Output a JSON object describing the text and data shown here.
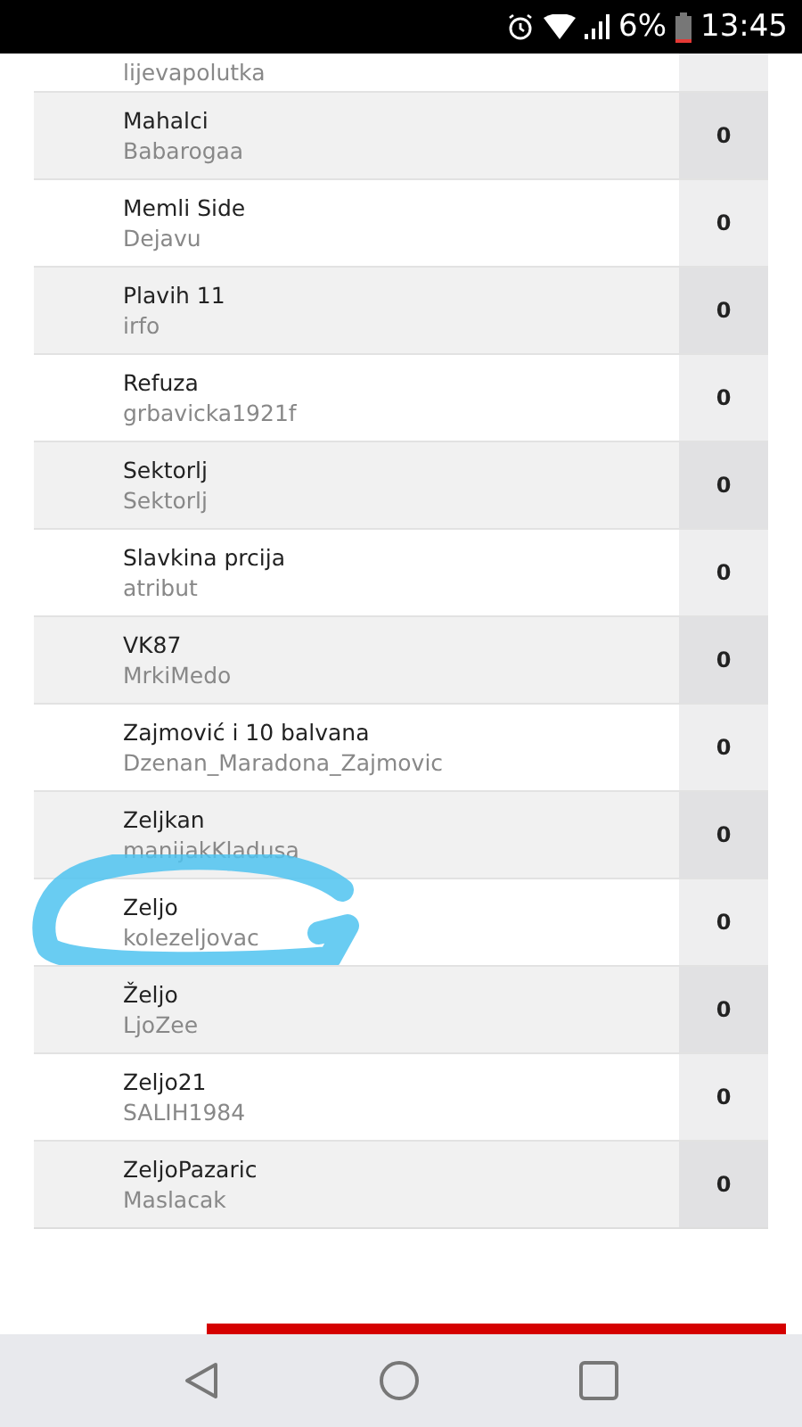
{
  "status_bar": {
    "battery": "6%",
    "time": "13:45"
  },
  "rows": [
    {
      "username": "lijevapolutka",
      "circled": false
    },
    {
      "name": "Mahalci",
      "username": "Babarogaa",
      "score": "0",
      "circled": false
    },
    {
      "name": "Memli Side",
      "username": "Dejavu",
      "score": "0",
      "circled": false
    },
    {
      "name": "Plavih 11",
      "username": "irfo",
      "score": "0",
      "circled": false
    },
    {
      "name": "Refuza",
      "username": "grbavicka1921f",
      "score": "0",
      "circled": false
    },
    {
      "name": "Sektorlj",
      "username": "Sektorlj",
      "score": "0",
      "circled": false
    },
    {
      "name": "Slavkina prcija",
      "username": "atribut",
      "score": "0",
      "circled": false
    },
    {
      "name": "VK87",
      "username": "MrkiMedo",
      "score": "0",
      "circled": false
    },
    {
      "name": "Zajmović i 10 balvana",
      "username": "Dzenan_Maradona_Zajmovic",
      "score": "0",
      "circled": false
    },
    {
      "name": "Zeljkan",
      "username": "manijakKladusa",
      "score": "0",
      "circled": false
    },
    {
      "name": "Zeljo",
      "username": "kolezeljovac",
      "score": "0",
      "circled": true
    },
    {
      "name": "Željo",
      "username": "LjoZee",
      "score": "0",
      "circled": false
    },
    {
      "name": "Zeljo21",
      "username": "SALIH1984",
      "score": "0",
      "circled": false
    },
    {
      "name": "ZeljoPazaric",
      "username": "Maslacak",
      "score": "0",
      "circled": false
    }
  ]
}
